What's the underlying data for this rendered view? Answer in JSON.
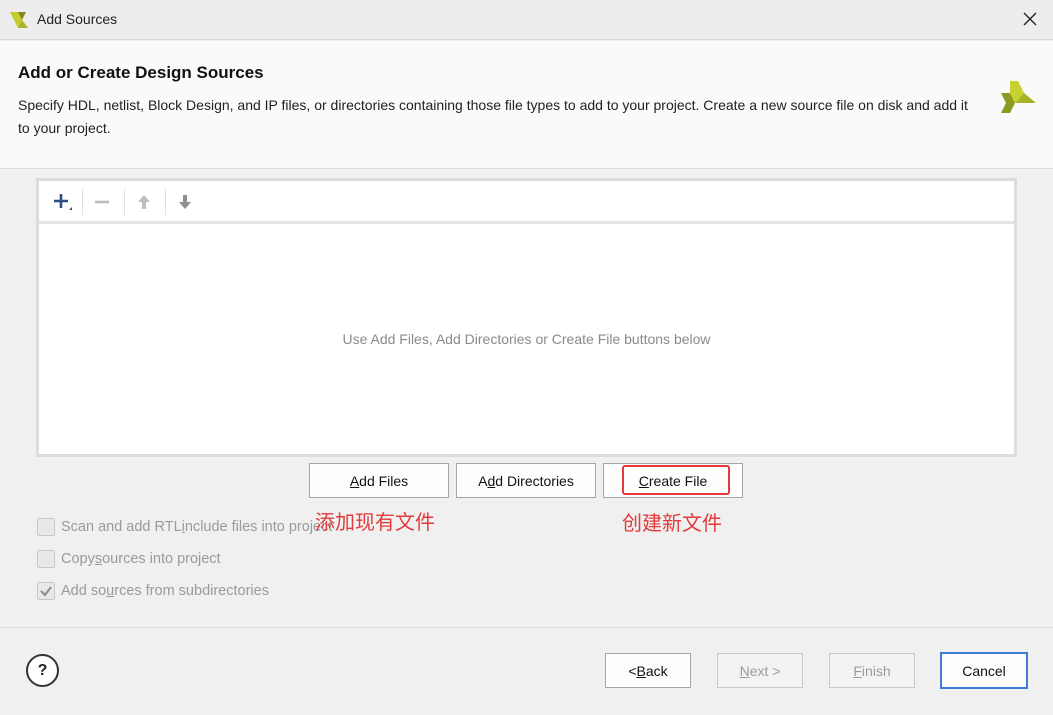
{
  "window": {
    "title": "Add Sources",
    "close_icon": "close-icon"
  },
  "header": {
    "title": "Add or Create Design Sources",
    "description": "Specify HDL, netlist, Block Design, and IP files, or directories containing those file types to add to your project. Create a new source file on disk and add it to your project."
  },
  "toolbar": {
    "icons": [
      "add-icon",
      "remove-icon",
      "move-up-icon",
      "move-down-icon"
    ]
  },
  "file_list": {
    "empty_message": "Use Add Files, Add Directories or Create File buttons below"
  },
  "actions": {
    "add_files": {
      "mnemonic": "A",
      "rest": "dd Files"
    },
    "add_directories": {
      "pre": "A",
      "mnemonic": "d",
      "rest": "d Directories"
    },
    "create_file": {
      "mnemonic": "C",
      "rest": "reate File"
    }
  },
  "annotations": {
    "existing": "添加现有文件",
    "new": "创建新文件"
  },
  "options": [
    {
      "pre": "Scan and add RTL ",
      "mnemonic": "i",
      "rest": "nclude files into project",
      "checked": false
    },
    {
      "pre": "Copy ",
      "mnemonic": "s",
      "rest": "ources into project",
      "checked": false
    },
    {
      "pre": "Add so",
      "mnemonic": "u",
      "rest": "rces from subdirectories",
      "checked": true
    }
  ],
  "footer": {
    "help": "?",
    "back": {
      "pre": "< ",
      "mnemonic": "B",
      "rest": "ack"
    },
    "next": {
      "mnemonic": "N",
      "rest": "ext >"
    },
    "finish": {
      "mnemonic": "F",
      "rest": "inish"
    },
    "cancel": "Cancel"
  },
  "colors": {
    "accent": "#3d7cd5",
    "annotation": "#e53a3a",
    "brand": "#9aa824"
  }
}
